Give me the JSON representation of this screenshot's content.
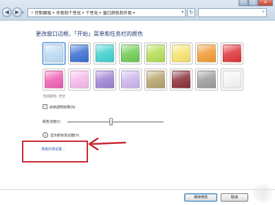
{
  "window": {
    "minimize_label": "—",
    "maximize_label": "□",
    "close_label": "✕"
  },
  "nav": {
    "back_glyph": "◀",
    "forward_glyph": "▶",
    "dropdown_glyph": "▾",
    "refresh_glyph": "↻",
    "search_glyph": "⌕"
  },
  "breadcrumb": {
    "lead": "»",
    "separator": "▸",
    "items": [
      "控制面板",
      "外观和个性化",
      "个性化",
      "窗口颜色和外观"
    ],
    "end_glyph": "▾"
  },
  "heading": "更改窗口边框、「开始」菜单和任务栏的颜色",
  "swatches": [
    {
      "name": "天空",
      "color": "#bcdcf6",
      "selected": true
    },
    {
      "name": "深蓝",
      "color": "#3a6fd0"
    },
    {
      "name": "青色",
      "color": "#3fd0cf"
    },
    {
      "name": "绿色",
      "color": "#6fcb52"
    },
    {
      "name": "黄绿",
      "color": "#b4dc54"
    },
    {
      "name": "黄色",
      "color": "#f5e36f"
    },
    {
      "name": "橙色",
      "color": "#f19a33"
    },
    {
      "name": "红色",
      "color": "#e0353a"
    },
    {
      "name": "粉红",
      "color": "#ee5eb4"
    },
    {
      "name": "淡粉",
      "color": "#f6b9ea"
    },
    {
      "name": "紫色",
      "color": "#9f82d4"
    },
    {
      "name": "淡紫",
      "color": "#cbb5ec"
    },
    {
      "name": "棕色",
      "color": "#b6a36c"
    },
    {
      "name": "深红",
      "color": "#8a2e37"
    },
    {
      "name": "灰色",
      "color": "#9c9c9c"
    },
    {
      "name": "白色",
      "color": "#f4f4f4"
    }
  ],
  "current_color": {
    "label": "当前颜色",
    "value": "天空"
  },
  "transparency": {
    "label": "启用透明效果(N)",
    "checked": true,
    "check_glyph": "✓"
  },
  "intensity": {
    "label": "颜色浓度(I):",
    "level": 0.45
  },
  "mixer": {
    "label": "显示颜色混合器(X)",
    "toggle_glyph": "⌄"
  },
  "advanced_link": "高级外观设置...",
  "buttons": {
    "save": "保存修改",
    "cancel": "取消"
  },
  "annotation": {
    "color": "#c9262e"
  }
}
